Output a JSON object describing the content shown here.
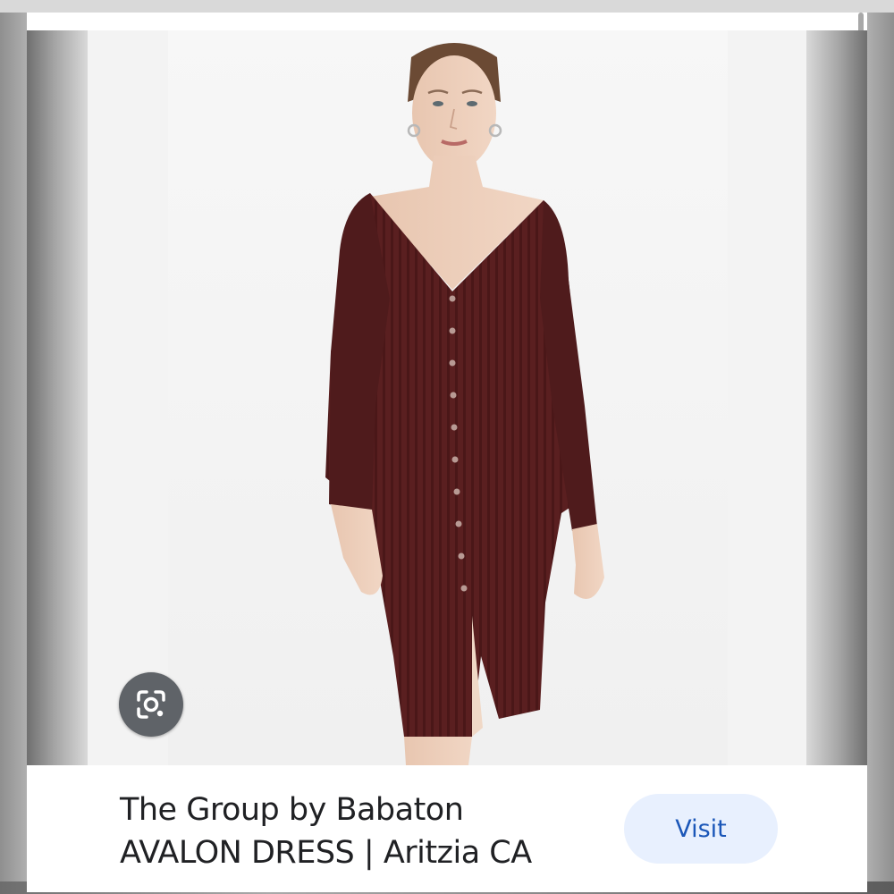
{
  "result": {
    "title_line1": "The Group by Babaton",
    "title_line2": "AVALON DRESS | Aritzia CA",
    "visit_label": "Visit"
  },
  "icons": {
    "lens": "google-lens-icon"
  },
  "colors": {
    "dress": "#5a1f20",
    "visit_bg": "#e8f0fe",
    "visit_text": "#1a56b8",
    "lens_bg": "#5f6368"
  }
}
